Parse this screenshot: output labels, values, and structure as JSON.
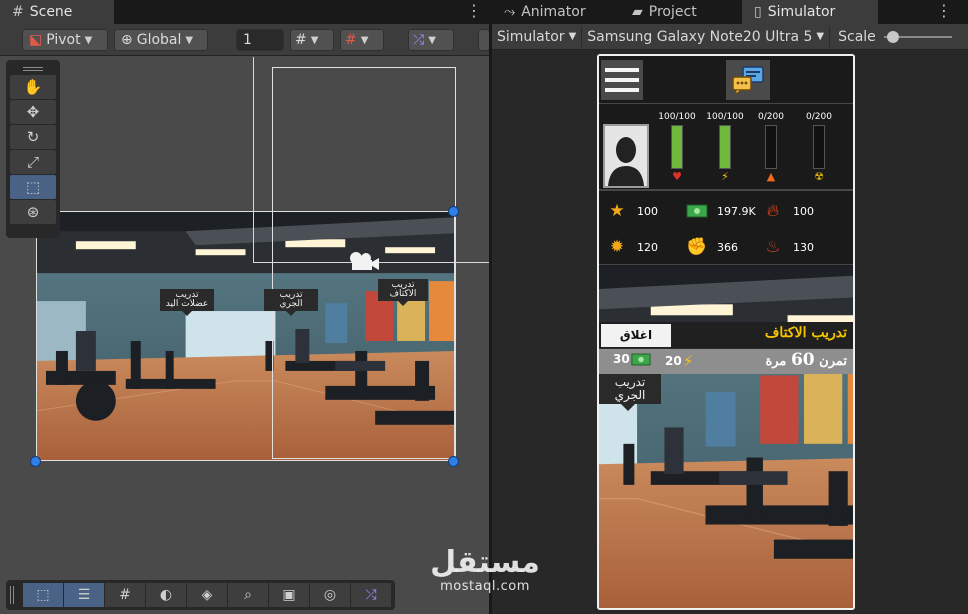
{
  "scene_tab": {
    "label": "Scene",
    "icon": "grid-icon"
  },
  "right_tabs": [
    {
      "label": "Animator",
      "icon": "animator-icon"
    },
    {
      "label": "Project",
      "icon": "folder-icon"
    },
    {
      "label": "Simulator",
      "icon": "phone-icon"
    }
  ],
  "scene_toolbar": {
    "pivot_label": "Pivot",
    "global_label": "Global",
    "grid_value": "1"
  },
  "tool_palette": [
    "hand-tool",
    "move-tool",
    "rotate-tool",
    "scale-tool",
    "rect-tool",
    "transform-tool"
  ],
  "scene_labels": {
    "arm_training": "تدريب عضلات اليد",
    "running_training": "تدريب الجري",
    "shoulder_training": "تدريب الاكتاف"
  },
  "simulator_toolbar": {
    "mode_label": "Simulator",
    "device_label": "Samsung Galaxy Note20 Ultra 5",
    "scale_label": "Scale",
    "scale_value": 0.05
  },
  "phone": {
    "bars": [
      {
        "value_text": "100/100",
        "fill": 1.0,
        "color": "#6fb83c",
        "icon": "heart-icon"
      },
      {
        "value_text": "100/100",
        "fill": 1.0,
        "color": "#6fb83c",
        "icon": "energy-icon"
      },
      {
        "value_text": "0/200",
        "fill": 0.0,
        "color": "#d83a1a",
        "icon": "fire-icon"
      },
      {
        "value_text": "0/200",
        "fill": 0.0,
        "color": "#e0b000",
        "icon": "hazard-icon"
      }
    ],
    "resources": [
      {
        "icon": "star-icon",
        "value": "100"
      },
      {
        "icon": "cash-icon",
        "value": "197.9K"
      },
      {
        "icon": "fire-icon",
        "value": "100"
      },
      {
        "icon": "brain-icon",
        "value": "120"
      },
      {
        "icon": "muscle-icon",
        "value": "366"
      },
      {
        "icon": "meat-icon",
        "value": "130"
      }
    ],
    "popup": {
      "close_label": "اغلاق",
      "title": "تدريب الاكتاف",
      "money_cost": "30",
      "energy_cost": "20",
      "reps_prefix": "تمرن",
      "reps_number": "60",
      "reps_suffix": "مرة"
    },
    "jog_label": "تدريب الجري"
  },
  "watermark": {
    "arabic": "مستقل",
    "latin": "mostaql.com"
  }
}
